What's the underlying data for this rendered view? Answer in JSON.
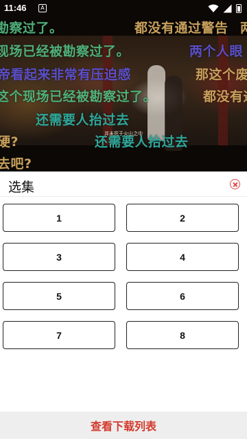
{
  "status_bar": {
    "time": "11:46",
    "notification_glyph": "A"
  },
  "danmaku": [
    {
      "text": "勘察过了。",
      "color": "#4fb07a"
    },
    {
      "text": "都没有通过警告",
      "color": "#c9a15c"
    },
    {
      "text": "两",
      "color": "#c9a15c"
    },
    {
      "text": "现场已经被勘察过了。",
      "color": "#4fb07a"
    },
    {
      "text": "两个人眼",
      "color": "#5a4fc8"
    },
    {
      "text": "帝看起来非常有压迫感",
      "color": "#5a4fc8"
    },
    {
      "text": "那这个废",
      "color": "#c9a15c"
    },
    {
      "text": "这个现场已经被勘察过了。",
      "color": "#4fb07a"
    },
    {
      "text": "都没有通",
      "color": "#c9a15c"
    },
    {
      "text": "还需要人抬过去",
      "color": "#2ea79a"
    },
    {
      "text": "硬?",
      "color": "#c9a15c"
    },
    {
      "text": "还需要人抬过去",
      "color": "#2ea79a"
    },
    {
      "text": "去吧?",
      "color": "#c9a15c"
    }
  ],
  "subtitle": "并未死于火山之中",
  "episode_sheet": {
    "title": "选集",
    "episodes": [
      "1",
      "2",
      "3",
      "4",
      "5",
      "6",
      "7",
      "8"
    ],
    "footer_label": "查看下载列表"
  },
  "icons": [
    "notification-icon",
    "wifi-icon",
    "signal-icon",
    "battery-icon",
    "close-icon"
  ]
}
